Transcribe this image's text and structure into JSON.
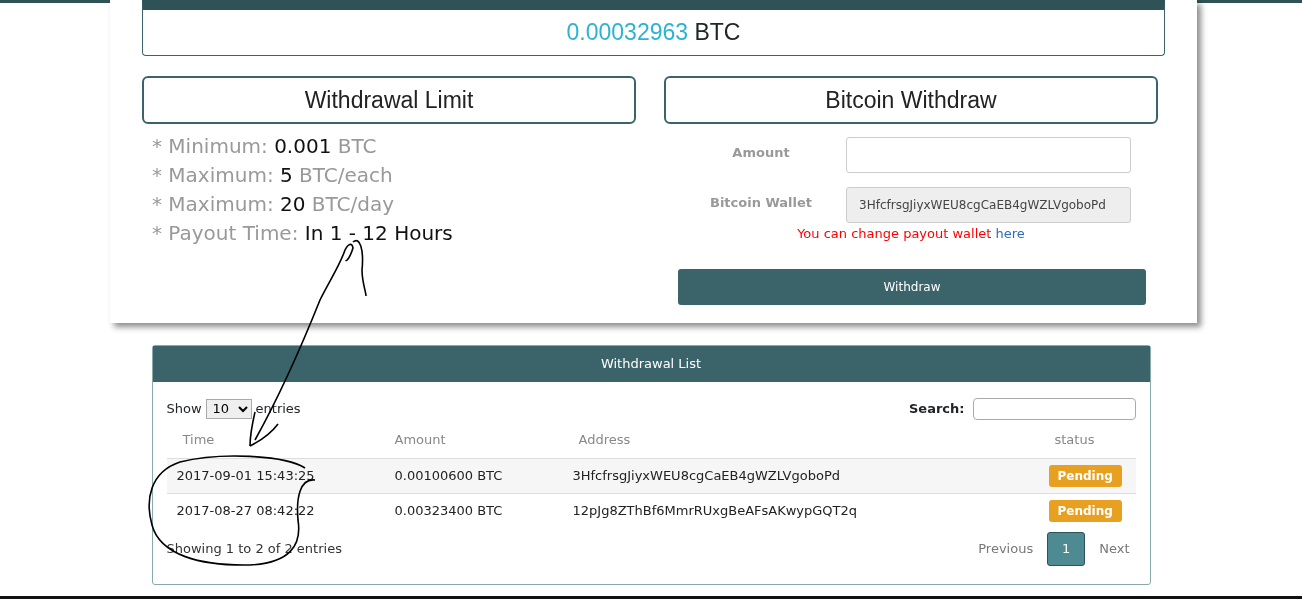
{
  "balance": {
    "amount": "0.00032963",
    "unit": "BTC"
  },
  "limit_panel": {
    "title": "Withdrawal Limit",
    "items": [
      {
        "label": "* Minimum:",
        "value": "0.001",
        "unit": "BTC"
      },
      {
        "label": "* Maximum:",
        "value": "5",
        "unit": "BTC/each"
      },
      {
        "label": "* Maximum:",
        "value": "20",
        "unit": "BTC/day"
      },
      {
        "label": "* Payout Time:",
        "value": "In 1 - 12 Hours"
      }
    ]
  },
  "withdraw_panel": {
    "title": "Bitcoin Withdraw",
    "fields": [
      {
        "label": "Amount",
        "disabled": false
      },
      {
        "label": "Bitcoin Wallet",
        "value": "3HfcfrsgJiyxWEU8cgCaEB4gWZLVgoboPd",
        "disabled": true
      }
    ],
    "note": "You can change payout wallet",
    "note_link": "here",
    "button": "Withdraw"
  },
  "withdrawal_list": {
    "title": "Withdrawal List",
    "show_label": "Show",
    "page_size": "10",
    "entries_label": "entries",
    "search_label": "Search:",
    "columns": [
      "Time",
      "Amount",
      "Address",
      "status"
    ],
    "rows": [
      {
        "time": "2017-09-01 15:43:25",
        "amount": "0.00100600 BTC",
        "address": "3HfcfrsgJiyxWEU8cgCaEB4gWZLVgoboPd",
        "status": "Pending"
      },
      {
        "time": "2017-08-27 08:42:22",
        "amount": "0.00323400 BTC",
        "address": "12pJg8ZThBf6MmrRUxgBeAFsAKwypGQT2q",
        "status": "Pending"
      }
    ],
    "info": "Showing 1 to 2 of 2 entries",
    "pagination": {
      "previous": "Previous",
      "next": "Next",
      "pages": [
        {
          "label": "1",
          "selected": true
        }
      ]
    }
  }
}
